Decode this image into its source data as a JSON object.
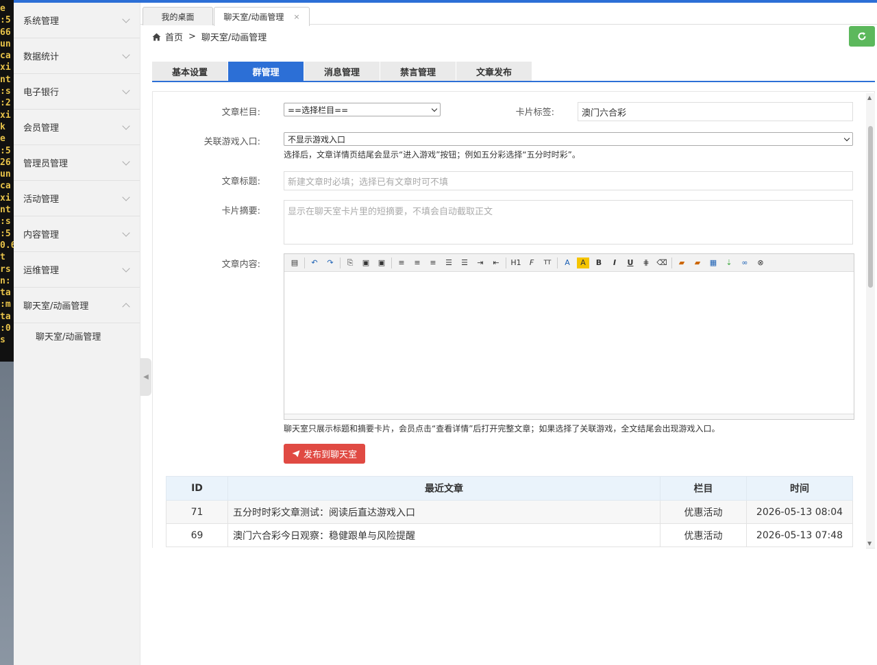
{
  "terminal": {
    "lines": [
      "e",
      ":5",
      "66",
      "un",
      "ca",
      "xi",
      "nt",
      ":s",
      ":2",
      "xi",
      "k",
      "e",
      ":5",
      "26",
      "un",
      "ca",
      "xi",
      "nt",
      ":s",
      ":5",
      "0.6",
      "t",
      "rs",
      "n:",
      "ta",
      ":m",
      "ta",
      ":0",
      "s"
    ]
  },
  "sidebar": {
    "items": [
      {
        "label": "系统管理"
      },
      {
        "label": "数据统计"
      },
      {
        "label": "电子银行"
      },
      {
        "label": "会员管理"
      },
      {
        "label": "管理员管理"
      },
      {
        "label": "活动管理"
      },
      {
        "label": "内容管理"
      },
      {
        "label": "运维管理"
      },
      {
        "label": "聊天室/动画管理"
      }
    ],
    "sub_item": "聊天室/动画管理"
  },
  "tabs": {
    "items": [
      {
        "label": "我的桌面"
      },
      {
        "label": "聊天室/动画管理",
        "close": "×"
      }
    ]
  },
  "breadcrumb": {
    "home": "首页",
    "sep": ">",
    "current": "聊天室/动画管理"
  },
  "refresh_icon": "refresh-icon",
  "nav_tabs": {
    "items": [
      {
        "label": "基本设置"
      },
      {
        "label": "群管理"
      },
      {
        "label": "消息管理"
      },
      {
        "label": "禁言管理"
      },
      {
        "label": "文章发布"
      }
    ],
    "active": "群管理"
  },
  "form": {
    "category_label": "文章栏目:",
    "category_value": "==选择栏目==",
    "card_tag_label": "卡片标签:",
    "card_tag_value": "澳门六合彩",
    "game_label": "关联游戏入口:",
    "game_value": "不显示游戏入口",
    "game_hint": "选择后，文章详情页结尾会显示“进入游戏”按钮；例如五分彩选择“五分时时彩”。",
    "title_label": "文章标题:",
    "title_placeholder": "新建文章时必填；选择已有文章时可不填",
    "summary_label": "卡片摘要:",
    "summary_placeholder": "显示在聊天室卡片里的短摘要，不填会自动截取正文",
    "content_label": "文章内容:",
    "editor_hint": "聊天室只展示标题和摘要卡片，会员点击“查看详情”后打开完整文章；如果选择了关联游戏，全文结尾会出现游戏入口。",
    "publish_label": "发布到聊天室"
  },
  "editor_toolbar": {
    "h1": "H1",
    "font": "F",
    "size": "TT",
    "bold": "B",
    "italic": "I",
    "underline": "U",
    "font_color": "A",
    "bg_color": "A"
  },
  "table": {
    "headers": [
      "ID",
      "最近文章",
      "栏目",
      "时间"
    ],
    "rows": [
      [
        "71",
        "五分时时彩文章测试：阅读后直达游戏入口",
        "优惠活动",
        "2026-05-13 08:04"
      ],
      [
        "69",
        "澳门六合彩今日观察：稳健跟单与风险提醒",
        "优惠活动",
        "2026-05-13 07:48"
      ]
    ]
  }
}
